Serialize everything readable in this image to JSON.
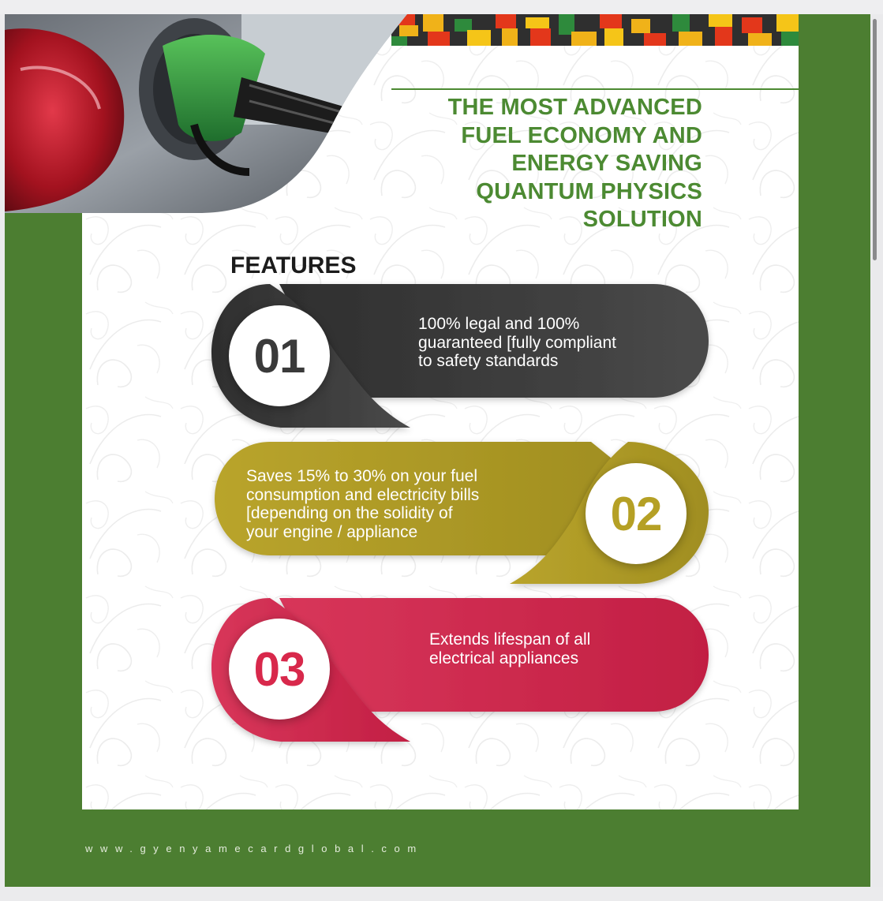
{
  "headline": {
    "lines": [
      "THE MOST ADVANCED",
      "FUEL ECONOMY AND",
      "ENERGY SAVING",
      "QUANTUM PHYSICS",
      "SOLUTION"
    ]
  },
  "features": {
    "heading": "FEATURES",
    "items": [
      {
        "number": "01",
        "lines": [
          "100% legal and 100%",
          "guaranteed [fully compliant",
          "to safety standards"
        ],
        "color": "#3f3f3f"
      },
      {
        "number": "02",
        "lines": [
          "Saves 15% to 30% on your fuel",
          "consumption and electricity bills",
          "[depending on the solidity of",
          "your engine / appliance"
        ],
        "color": "#b3a02a"
      },
      {
        "number": "03",
        "lines": [
          "Extends lifespan of all",
          "electrical appliances"
        ],
        "color": "#d02a4d"
      }
    ]
  },
  "footer": {
    "website": "www.gyenyamecardglobal.com"
  },
  "colors": {
    "brand_green": "#4c7e31",
    "headline_green": "#4c8a32"
  }
}
